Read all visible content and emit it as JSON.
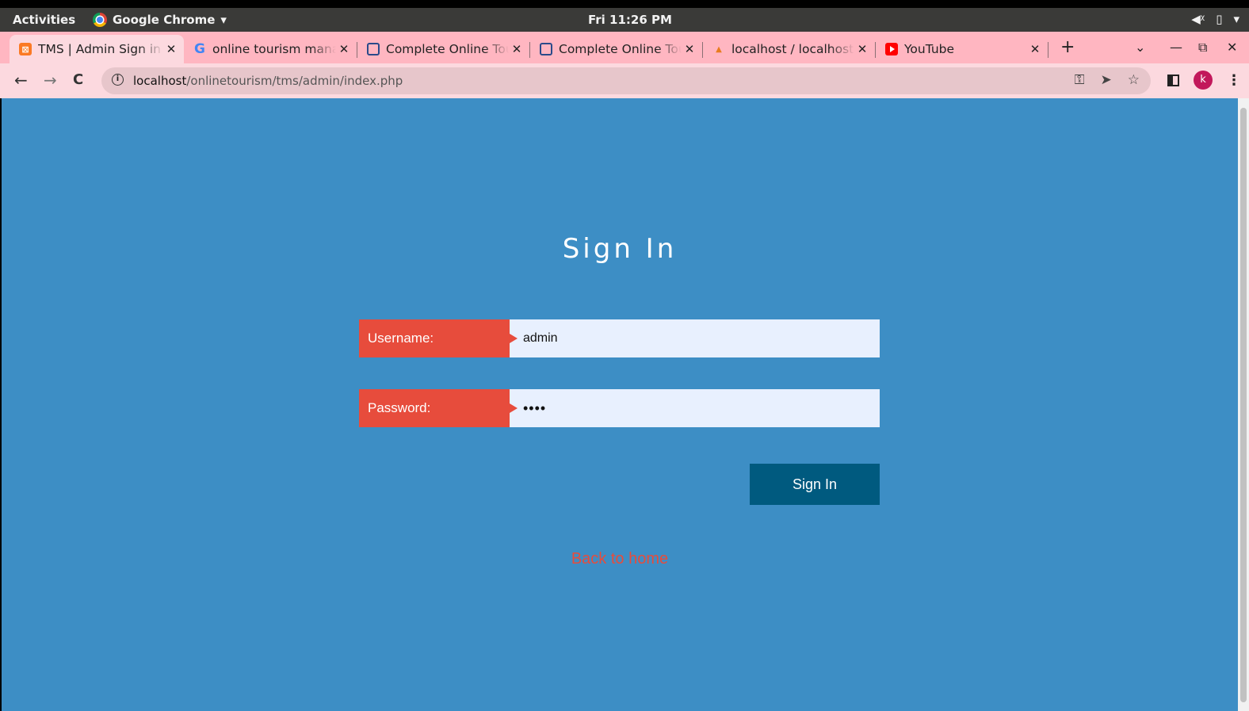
{
  "system_bar": {
    "activities": "Activities",
    "app_name": "Google Chrome",
    "app_menu_caret": "▾",
    "clock": "Fri 11:26 PM",
    "volume_icon": "◀ᵡ",
    "battery_icon": "▯",
    "menu_caret": "▾"
  },
  "tabs": [
    {
      "title": "TMS | Admin Sign in",
      "favicon": "xampp-icon",
      "active": true
    },
    {
      "title": "online tourism management",
      "favicon": "google-icon",
      "active": false
    },
    {
      "title": "Complete Online Tourism",
      "favicon": "shield-icon",
      "active": false
    },
    {
      "title": "Complete Online Tourism",
      "favicon": "shield-icon",
      "active": false
    },
    {
      "title": "localhost / localhost",
      "favicon": "phpmyadmin-icon",
      "active": false
    },
    {
      "title": "YouTube",
      "favicon": "youtube-icon",
      "active": false
    }
  ],
  "tab_close_glyph": "✕",
  "new_tab": "+",
  "window_controls": {
    "tab_search": "⌄",
    "minimize": "—",
    "restore": "⧉",
    "close": "✕"
  },
  "nav": {
    "back": "←",
    "forward": "→",
    "reload": "C"
  },
  "address_bar": {
    "info_glyph": "i",
    "host": "localhost",
    "path": "/onlinetourism/tms/admin/index.php",
    "key_icon": "⚿",
    "send_icon": "➤",
    "star_icon": "☆"
  },
  "profile": {
    "initial": "k",
    "color": "#c2185b"
  },
  "menu_glyph": "⋮",
  "page": {
    "background": "#3d8ec5",
    "title": "Sign In",
    "username_label": "Username:",
    "username_value": "admin",
    "password_label": "Password:",
    "password_value": "••••",
    "signin_button": "Sign In",
    "back_link": "Back to home",
    "accent_color": "#e74c3c",
    "button_color": "#005a7f"
  }
}
